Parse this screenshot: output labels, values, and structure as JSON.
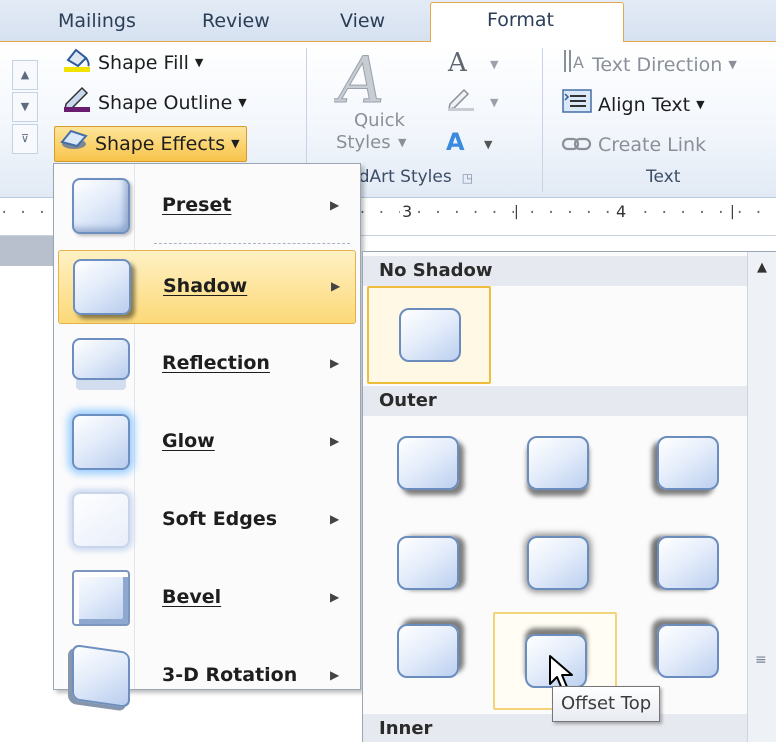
{
  "tabs": [
    "Mailings",
    "Review",
    "View",
    "Format"
  ],
  "active_tab": "Format",
  "ribbon": {
    "shape_styles": {
      "shape_fill": "Shape Fill",
      "shape_outline": "Shape Outline",
      "shape_effects": "Shape Effects"
    },
    "wordart": {
      "quick_styles_line1": "Quick",
      "quick_styles_line2": "Styles",
      "group_label": "rdArt Styles"
    },
    "text_group": {
      "text_direction": "Text Direction",
      "align_text": "Align Text",
      "create_link": "Create Link",
      "group_label": "Text"
    }
  },
  "ruler": {
    "marks": [
      {
        "label": "3"
      },
      {
        "label": "4"
      }
    ]
  },
  "effects_menu": {
    "items": [
      {
        "label": "Preset",
        "mnemonic": "P",
        "highlighted": false
      },
      {
        "label": "Shadow",
        "mnemonic": "S",
        "highlighted": true
      },
      {
        "label": "Reflection",
        "mnemonic": "R",
        "highlighted": false
      },
      {
        "label": "Glow",
        "mnemonic": "G",
        "highlighted": false
      },
      {
        "label": "Soft Edges",
        "mnemonic": "E",
        "highlighted": false
      },
      {
        "label": "Bevel",
        "mnemonic": "B",
        "highlighted": false
      },
      {
        "label": "3-D Rotation",
        "mnemonic": "D",
        "highlighted": false
      }
    ]
  },
  "shadow_gallery": {
    "no_shadow_label": "No Shadow",
    "outer_label": "Outer",
    "inner_label": "Inner",
    "tooltip": "Offset Top",
    "selected": "No Shadow",
    "hovered": "Offset Top"
  },
  "colors": {
    "accent_orange": "#e4a94a",
    "highlight_yellow": "#fcd978",
    "shape_blue": "#6b8dbe"
  }
}
